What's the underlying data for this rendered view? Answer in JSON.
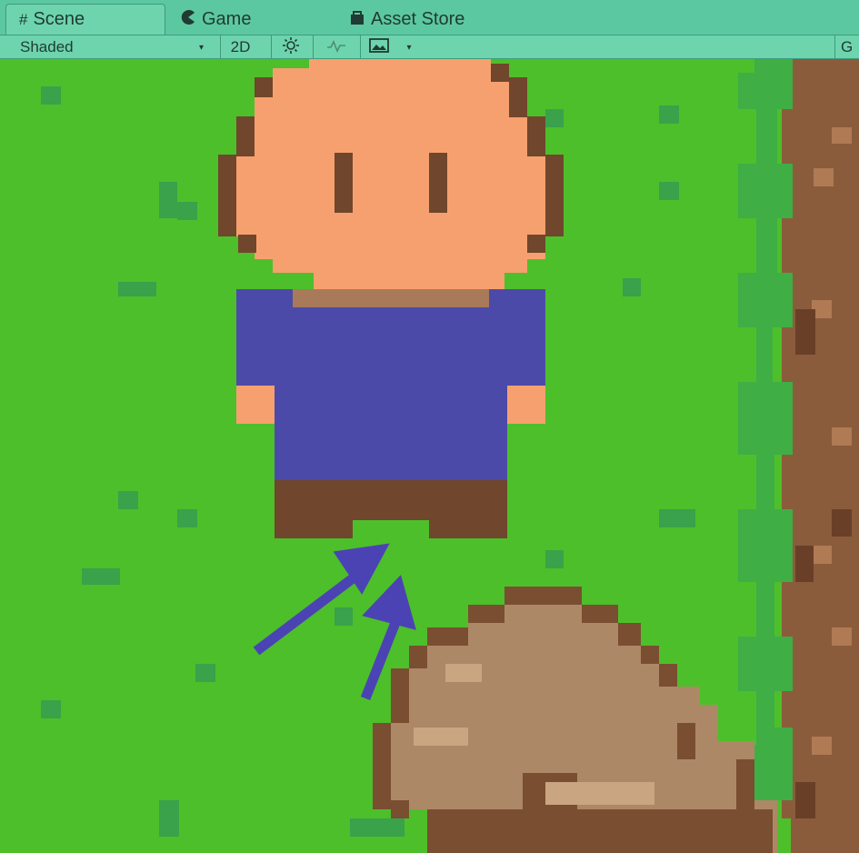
{
  "tabs": [
    {
      "label": "Scene",
      "icon": "scene-grid-icon"
    },
    {
      "label": "Game",
      "icon": "game-pacman-icon"
    },
    {
      "label": "Asset Store",
      "icon": "asset-store-bag-icon"
    }
  ],
  "toolbar": {
    "shading_mode": "Shaded",
    "mode_2d": "2D",
    "gizmos_label": "G"
  },
  "colors": {
    "tabbar": "#5cc8a1",
    "grass": "#4dbf2a",
    "skin": "#f7a06f",
    "shirt": "#4c4aa8",
    "boots": "#70462c",
    "rock": "#ad8866",
    "dirt": "#8a5c3c",
    "arrow": "#4b43b4"
  }
}
